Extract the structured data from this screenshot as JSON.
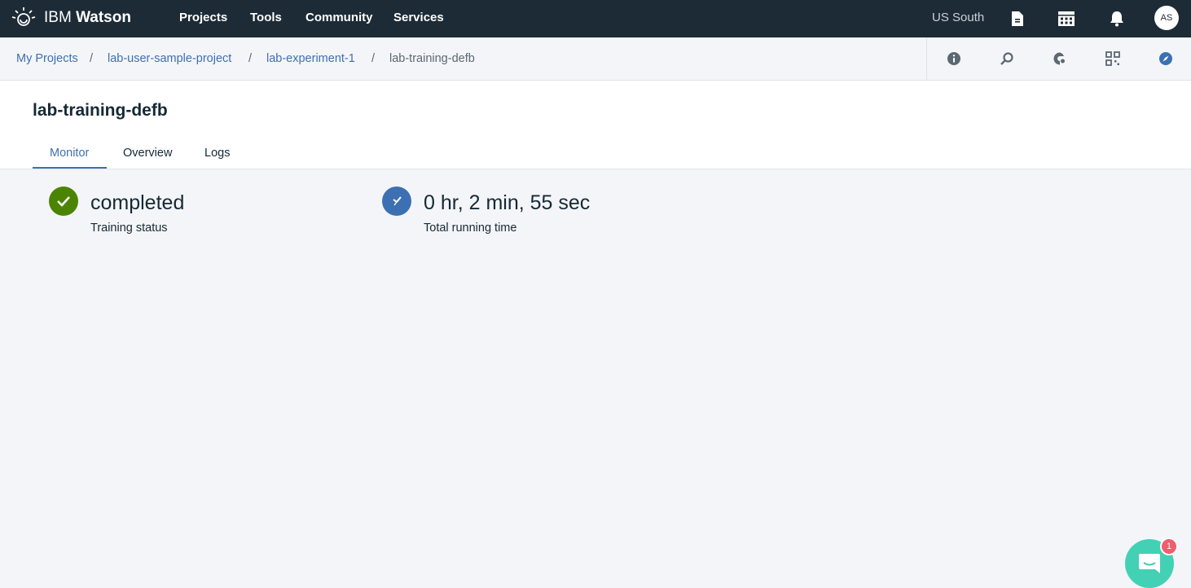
{
  "topbar": {
    "brand_prefix": "IBM",
    "brand_name": "Watson",
    "nav": [
      {
        "label": "Projects"
      },
      {
        "label": "Tools"
      },
      {
        "label": "Community"
      },
      {
        "label": "Services"
      }
    ],
    "region": "US South",
    "avatar_initials": "AS",
    "icons": [
      "documentation-icon",
      "catalog-icon",
      "notifications-icon"
    ]
  },
  "breadcrumb": {
    "items": [
      {
        "label": "My Projects"
      },
      {
        "label": "lab-user-sample-project"
      },
      {
        "label": "lab-experiment-1"
      },
      {
        "label": "lab-training-defb"
      }
    ],
    "separator": "/",
    "tool_icons": [
      "info-icon",
      "search-icon",
      "palette-icon",
      "grid-icon",
      "compass-icon"
    ]
  },
  "page": {
    "title": "lab-training-defb",
    "tabs": [
      {
        "label": "Monitor",
        "active": true
      },
      {
        "label": "Overview",
        "active": false
      },
      {
        "label": "Logs",
        "active": false
      }
    ]
  },
  "stats": {
    "status": {
      "value": "completed",
      "label": "Training status",
      "color": "#4b8400"
    },
    "runtime": {
      "value": "0 hr, 2 min, 55 sec",
      "label": "Total running time",
      "color": "#3d70b2"
    }
  },
  "chat": {
    "badge_count": "1",
    "accent": "#42d1b4"
  }
}
